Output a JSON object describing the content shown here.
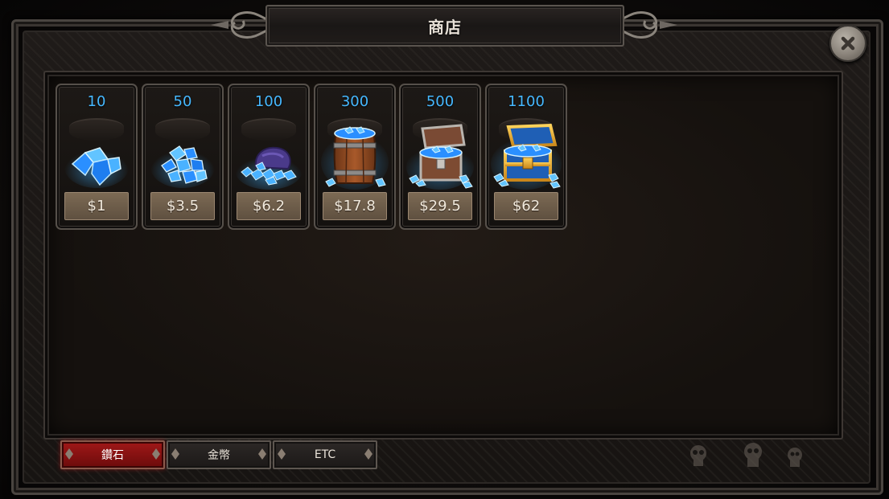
{
  "title": "商店",
  "close_icon": "close-x-icon",
  "colors": {
    "amount_text": "#46b8ff",
    "price_button": "#6e5d4a",
    "active_tab": "#8b1212"
  },
  "shop_items": [
    {
      "amount": "10",
      "price": "$1",
      "icon": "gem-pile-icon"
    },
    {
      "amount": "50",
      "price": "$3.5",
      "icon": "gem-heap-icon"
    },
    {
      "amount": "100",
      "price": "$6.2",
      "icon": "gem-pouch-icon"
    },
    {
      "amount": "300",
      "price": "$17.8",
      "icon": "gem-barrel-icon"
    },
    {
      "amount": "500",
      "price": "$29.5",
      "icon": "gem-chest-icon"
    },
    {
      "amount": "1100",
      "price": "$62",
      "icon": "gold-gem-chest-icon"
    }
  ],
  "tabs": [
    {
      "label": "鑽石",
      "active": true
    },
    {
      "label": "金幣",
      "active": false
    },
    {
      "label": "ETC",
      "active": false
    }
  ]
}
